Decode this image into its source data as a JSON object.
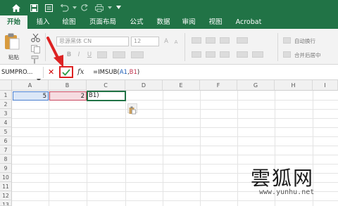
{
  "ribbon_tabs": [
    {
      "label": "开始",
      "active": true
    },
    {
      "label": "插入"
    },
    {
      "label": "绘图"
    },
    {
      "label": "页面布局"
    },
    {
      "label": "公式"
    },
    {
      "label": "数据"
    },
    {
      "label": "审阅"
    },
    {
      "label": "视图"
    },
    {
      "label": "Acrobat"
    }
  ],
  "ribbon": {
    "paste_label": "粘贴",
    "font_name": "思源黑体 CN",
    "font_size": "12",
    "bold": "B",
    "italic": "I",
    "underline": "U",
    "wrap_text": "自动换行",
    "merge_center": "合并后居中"
  },
  "formula_bar": {
    "name_box": "SUMPRO...",
    "cancel_glyph": "✕",
    "fx_label": "fx",
    "formula_prefix": "=IMSUB(",
    "ref_a": "A1",
    "comma": ",",
    "ref_b": "B1",
    "formula_suffix": ")"
  },
  "columns": [
    "A",
    "B",
    "C",
    "D",
    "E",
    "F",
    "G",
    "H",
    "I"
  ],
  "rows": [
    "1",
    "2",
    "3",
    "4",
    "5",
    "6",
    "7",
    "8",
    "9",
    "10",
    "11",
    "12",
    "13"
  ],
  "cells": {
    "A1": "5",
    "B1": "2",
    "C1": "B1)"
  },
  "watermark": {
    "title": "雲狐网",
    "url": "www.yunhu.net"
  },
  "colors": {
    "excel_green": "#217346",
    "ref_a": "#1f5fb8",
    "ref_b": "#c0334d",
    "annotation_red": "#dd2222"
  }
}
